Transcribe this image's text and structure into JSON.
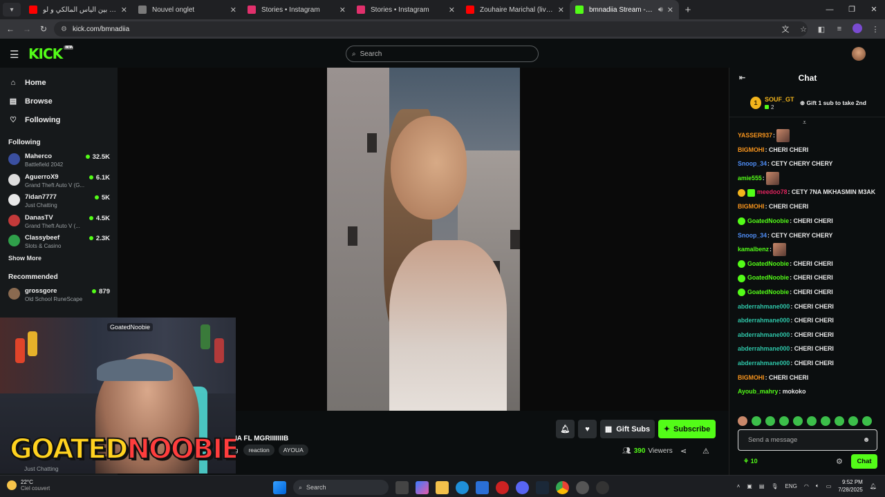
{
  "browser": {
    "tabs": [
      {
        "title": "أش واقع بين الياس المالكي و لو...",
        "favicon_color": "#ff0000",
        "active": false
      },
      {
        "title": "Nouvel onglet",
        "favicon_color": "#7a7a7a",
        "active": false
      },
      {
        "title": "Stories • Instagram",
        "favicon_color": "#e1306c",
        "active": false
      },
      {
        "title": "Stories • Instagram",
        "favicon_color": "#e1306c",
        "active": false
      },
      {
        "title": "Zouhaire Marichal (live) زوهير ماريشال",
        "favicon_color": "#ff0000",
        "active": false
      },
      {
        "title": "bmnadiia Stream - Watch Live",
        "favicon_color": "#53fc18",
        "active": true
      }
    ],
    "new_tab_label": "+",
    "url": "kick.com/bmnadiia"
  },
  "kick": {
    "logo": "KICK",
    "logo_badge": "BETA",
    "search_placeholder": "Search",
    "brand_color": "#53fc18"
  },
  "sidebar": {
    "nav": [
      {
        "label": "Home",
        "icon": "home-icon"
      },
      {
        "label": "Browse",
        "icon": "browse-icon"
      },
      {
        "label": "Following",
        "icon": "heart-icon"
      }
    ],
    "following_title": "Following",
    "following": [
      {
        "name": "Maherco",
        "game": "Battlefield 2042",
        "viewers": "32.5K",
        "color": "#3a4fa0"
      },
      {
        "name": "AguerroX9",
        "game": "Grand Theft Auto V (G...",
        "viewers": "6.1K",
        "color": "#dddddd"
      },
      {
        "name": "7idan7777",
        "game": "Just Chatting",
        "viewers": "5K",
        "color": "#e8e8e8"
      },
      {
        "name": "DanasTV",
        "game": "Grand Theft Auto V (...",
        "viewers": "4.5K",
        "color": "#c33a3a"
      },
      {
        "name": "Classybeef",
        "game": "Slots & Casino",
        "viewers": "2.3K",
        "color": "#2fa04a"
      }
    ],
    "show_more": "Show More",
    "recommended_title": "Recommended",
    "recommended": [
      {
        "name": "grossgore",
        "game": "Old School RuneScape",
        "viewers": "879",
        "color": "#8a6a50"
      }
    ],
    "bottom_category": "Just Chatting"
  },
  "stream": {
    "title": "IA FL MGRIIIIIIIB",
    "tags": [
      "reaction",
      "AYOUA"
    ],
    "tag_partial": "ng",
    "gift_subs_label": "Gift Subs",
    "subscribe_label": "Subscribe",
    "viewers": "390",
    "viewers_label": "Viewers"
  },
  "webcam": {
    "overlay_text_a": "GOATED",
    "overlay_text_b": "NOOBIE",
    "handle_tag": "GoatedNoobie"
  },
  "chat": {
    "title": "Chat",
    "pinned": {
      "rank": "1",
      "name": "SOUF_GT",
      "count": "2",
      "gift_text": "Gift 1 sub to take 2nd"
    },
    "messages": [
      {
        "user": "YASSER937",
        "color": "#f7941d",
        "text": "",
        "emote": true
      },
      {
        "user": "BIGMOHI",
        "color": "#f7941d",
        "text": "CHERI CHERI"
      },
      {
        "user": "Snoop_34",
        "color": "#4f8ef7",
        "text": "CETY CHERY CHERY"
      },
      {
        "user": "amie555",
        "color": "#53fc18",
        "text": "",
        "emote": true
      },
      {
        "user": "meedoo78",
        "color": "#e0245e",
        "text": "CETY 7NA MKHASMIN M3AK",
        "badges": true
      },
      {
        "user": "BIGMOHI",
        "color": "#f7941d",
        "text": "CHERI CHERI"
      },
      {
        "user": "GoatedNoobie",
        "color": "#53fc18",
        "text": "CHERI CHERI",
        "verified": true
      },
      {
        "user": "Snoop_34",
        "color": "#4f8ef7",
        "text": "CETY CHERY CHERY"
      },
      {
        "user": "kamalbenz",
        "color": "#53fc18",
        "text": "",
        "emote": true
      },
      {
        "user": "GoatedNoobie",
        "color": "#53fc18",
        "text": "CHERI CHERI",
        "verified": true
      },
      {
        "user": "GoatedNoobie",
        "color": "#53fc18",
        "text": "CHERI CHERI",
        "verified": true
      },
      {
        "user": "GoatedNoobie",
        "color": "#53fc18",
        "text": "CHERI CHERI",
        "verified": true
      },
      {
        "user": "abderrahmane000",
        "color": "#2ec5a8",
        "text": "CHERI CHERI"
      },
      {
        "user": "abderrahmane000",
        "color": "#2ec5a8",
        "text": "CHERI CHERI"
      },
      {
        "user": "abderrahmane000",
        "color": "#2ec5a8",
        "text": "CHERI CHERI"
      },
      {
        "user": "abderrahmane000",
        "color": "#2ec5a8",
        "text": "CHERI CHERI"
      },
      {
        "user": "abderrahmane000",
        "color": "#2ec5a8",
        "text": "CHERI CHERI"
      },
      {
        "user": "BIGMOHI",
        "color": "#f7941d",
        "text": "CHERI CHERI"
      },
      {
        "user": "Ayoub_mahry",
        "color": "#53fc18",
        "text": "mokoko"
      }
    ],
    "input_placeholder": "Send a message",
    "points": "10",
    "send_label": "Chat"
  },
  "taskbar": {
    "temp": "22°C",
    "weather": "Ciel couvert",
    "search_label": "Search",
    "lang": "ENG",
    "time": "9:52 PM",
    "date": "7/28/2025"
  }
}
